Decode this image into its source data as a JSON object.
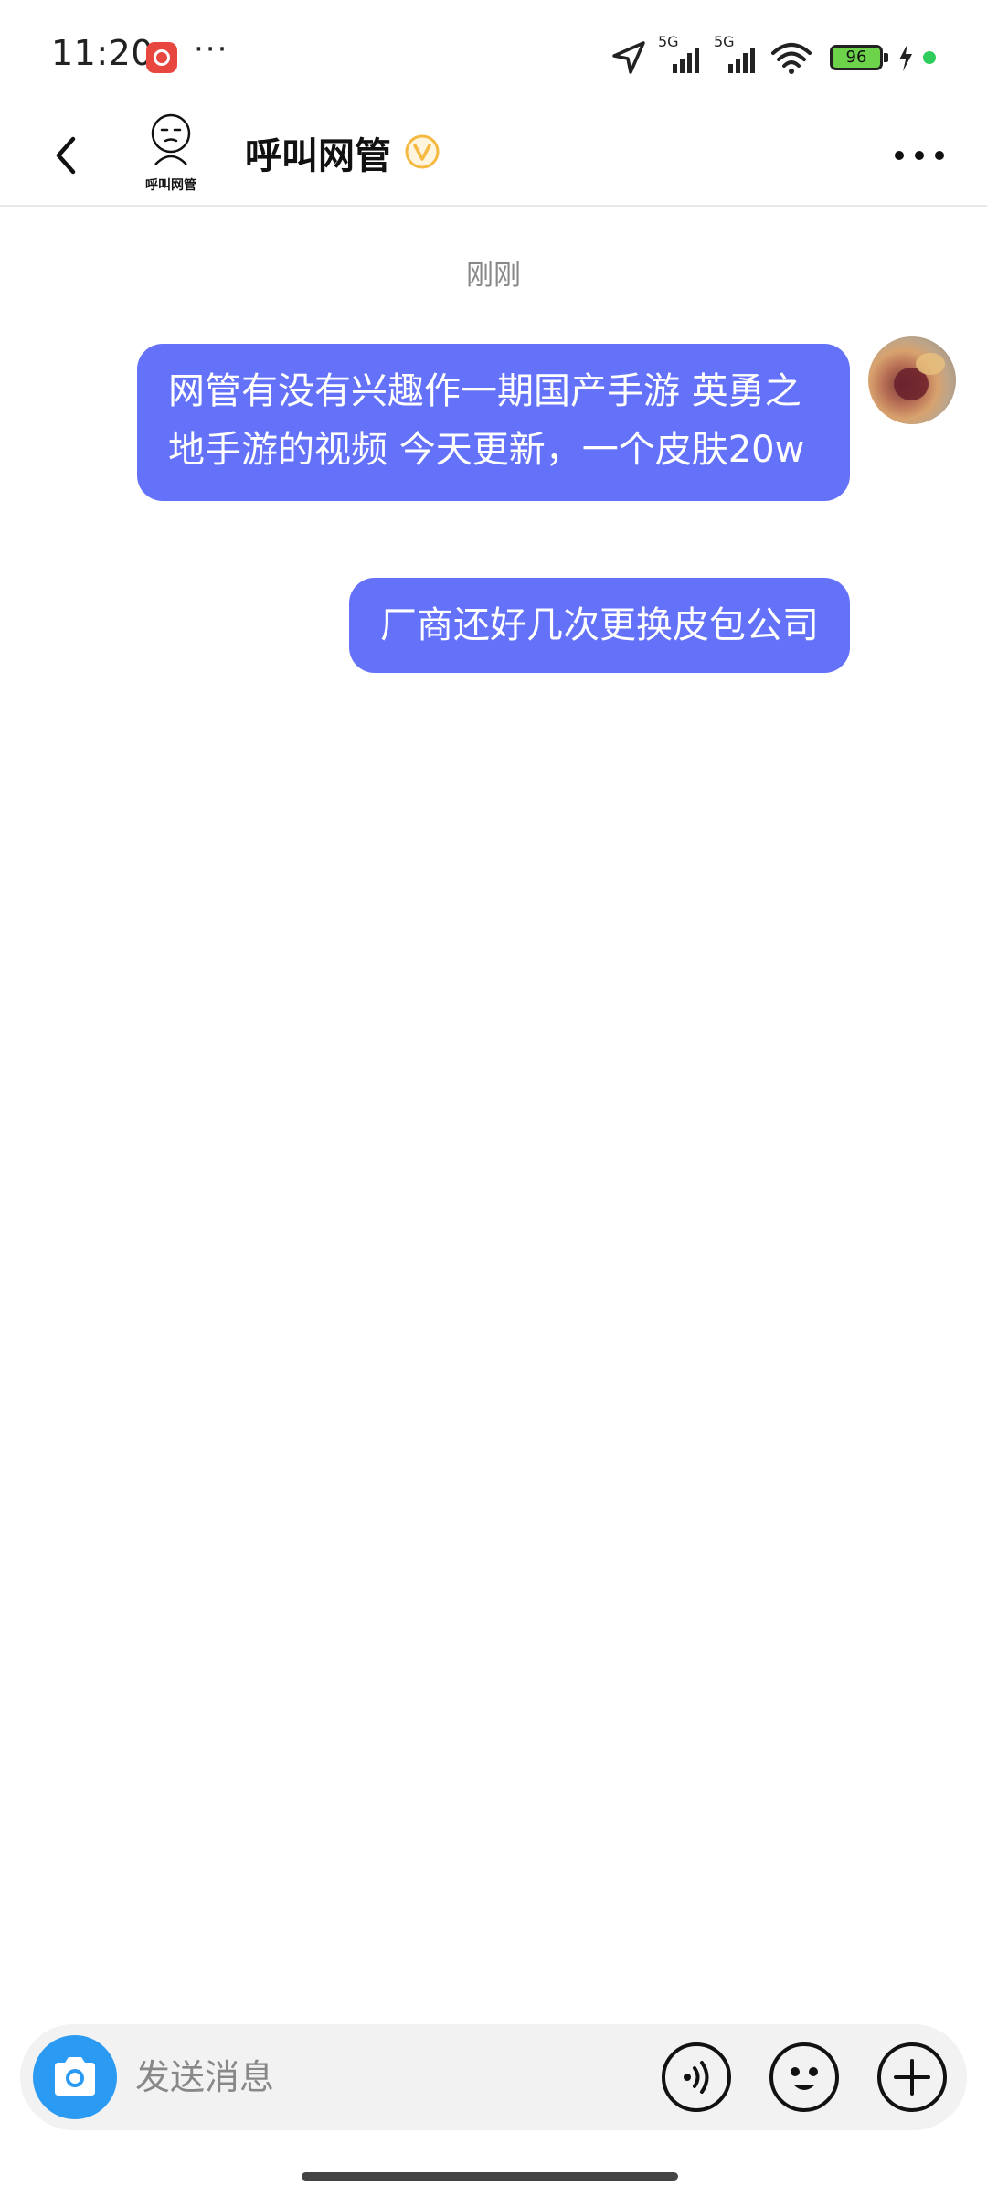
{
  "status_bar": {
    "time": "11:20",
    "more": "···",
    "signal_label_1": "5G",
    "signal_label_2": "5G",
    "battery": "96"
  },
  "header": {
    "title": "呼叫网管",
    "logo_text": "呼叫网管"
  },
  "chat": {
    "timestamp": "刚刚",
    "messages": [
      {
        "text": "网管有没有兴趣作一期国产手游 英勇之地手游的视频 今天更新，一个皮肤20w"
      },
      {
        "text": "厂商还好几次更换皮包公司"
      }
    ]
  },
  "input": {
    "placeholder": "发送消息"
  },
  "colors": {
    "bubble": "#6472f9",
    "camera_button": "#2b9af3",
    "verified_badge": "#f5b942"
  }
}
